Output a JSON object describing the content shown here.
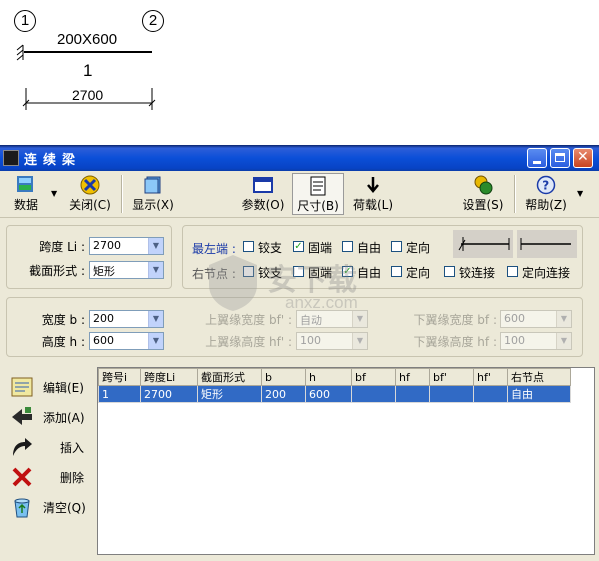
{
  "drawing": {
    "node_left": "1",
    "node_right": "2",
    "section": "200X600",
    "span_no": "1",
    "span_length": "2700"
  },
  "window": {
    "title": "连续梁"
  },
  "toolbar": {
    "data": "数据",
    "close": "关闭(C)",
    "display": "显示(X)",
    "params": "参数(O)",
    "size": "尺寸(B)",
    "load": "荷载(L)",
    "settings": "设置(S)",
    "help": "帮助(Z)"
  },
  "span_panel": {
    "span_label": "跨度 Li :",
    "span_value": "2700",
    "section_label": "截面形式 :",
    "section_value": "矩形"
  },
  "supports": {
    "left_label": "最左端 :",
    "right_label": "右节点 :",
    "hinge": "铰支",
    "fixed": "固端",
    "free": "自由",
    "guided": "定向",
    "hinge_connect": "铰连接",
    "guided_connect": "定向连接"
  },
  "dims": {
    "width_label": "宽度 b :",
    "width_value": "200",
    "height_label": "高度 h :",
    "height_value": "600",
    "top_flange_w_label": "上翼缘宽度 bf' :",
    "top_flange_w_value": "自动",
    "top_flange_h_label": "上翼缘高度 hf' :",
    "top_flange_h_value": "100",
    "bot_flange_w_label": "下翼缘宽度 bf :",
    "bot_flange_w_value": "600",
    "bot_flange_h_label": "下翼缘高度 hf :",
    "bot_flange_h_value": "100"
  },
  "side_buttons": {
    "edit": "编辑(E)",
    "add": "添加(A)",
    "insert": "插入",
    "delete": "删除",
    "clear": "清空(Q)"
  },
  "table": {
    "headers": [
      "跨号i",
      "跨度Li",
      "截面形式",
      "b",
      "h",
      "bf",
      "hf",
      "bf'",
      "hf'",
      "右节点"
    ],
    "rows": [
      [
        "1",
        "2700",
        "矩形",
        "200",
        "600",
        "",
        "",
        "",
        "",
        "自由"
      ]
    ]
  },
  "watermark": {
    "text": "安下载",
    "url": "anxz.com"
  },
  "colors": {
    "titlebar": "#0b4fd8",
    "window_bg": "#ece9d8",
    "selection": "#316ac5",
    "check_green": "#21a121"
  }
}
